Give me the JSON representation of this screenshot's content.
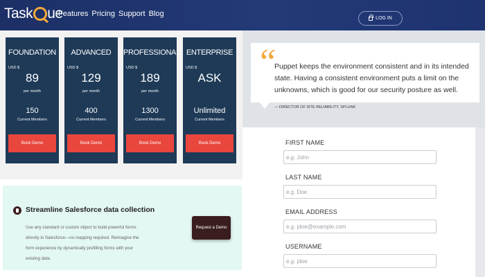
{
  "header": {
    "logo_prefix": "Task",
    "logo_suffix": "ue",
    "nav": [
      "Features",
      "Pricing",
      "Support",
      "Blog"
    ],
    "login_label": "LOG IN"
  },
  "plans": [
    {
      "name": "FOUNDATION",
      "currency": "USD $",
      "price": "89",
      "period": "per month",
      "members": "150",
      "members_label": "Current Members",
      "button": "Book Demo"
    },
    {
      "name": "ADVANCED",
      "currency": "USD $",
      "price": "129",
      "period": "per month",
      "members": "400",
      "members_label": "Current Members",
      "button": "Book Demo"
    },
    {
      "name": "PROFESSIONAL",
      "currency": "USD $",
      "price": "189",
      "period": "per month",
      "members": "1300",
      "members_label": "Current Members",
      "button": "Book Demo"
    },
    {
      "name": "ENTERPRISE",
      "currency": "USD $",
      "price": "ASK",
      "period": "",
      "members": "Unlimited",
      "members_label": "Current Members",
      "button": "Book Demo"
    }
  ],
  "card": {
    "title": "Streamline Salesforce data collection",
    "description": "Use any standard or custom object to build powerful forms directly in Salesforce—no mapping required. Reimagine the form experience by dynamically prefilling forms with your existing data.",
    "button": "Request a Demo"
  },
  "quote": {
    "mark": "“",
    "text": "Puppet keeps the environment consistent and in its intended state. Having a consistent environment puts a limit on the unknowns, which is good for our security posture as well.",
    "author": "— DIRECTOR OF SITE RELIABILITY, SPLUNK"
  },
  "form": {
    "first_name_label": "FIRST NAME",
    "first_name_placeholder": "e.g. John",
    "last_name_label": "LAST NAME",
    "last_name_placeholder": "e.g. Doe",
    "email_label": "EMAIL ADDRESS",
    "email_placeholder": "e.g. jdoe@example.com",
    "username_label": "USERNAME",
    "username_placeholder": "e.g. jdoe"
  },
  "colors": {
    "header_bg": "#1c2f66",
    "plan_bg": "#1e3a57",
    "demo_button": "#e9463d",
    "accent": "#f2a93b",
    "card_bg": "#e3f7f3",
    "card_button": "#3a1d1f"
  }
}
